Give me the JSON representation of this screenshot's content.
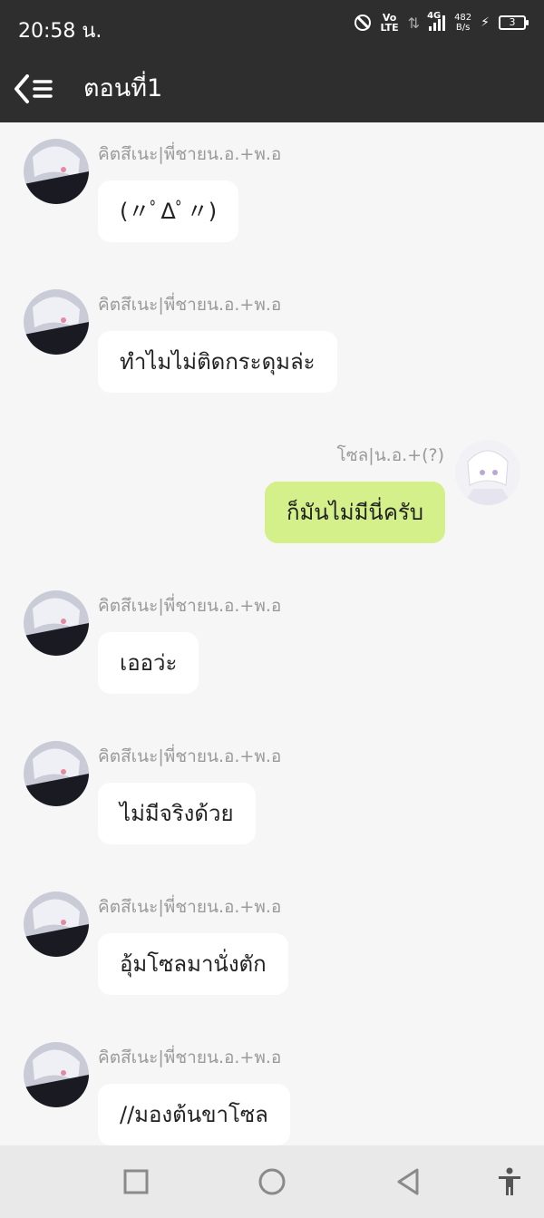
{
  "status_bar": {
    "time": "20:58 น.",
    "volte_top": "Vo",
    "volte_bottom": "LTE",
    "network": "4G",
    "speed_value": "482",
    "speed_unit": "B/s",
    "battery": "3"
  },
  "header": {
    "title": "ตอนที่1",
    "back_icon": "back-menu-icon"
  },
  "messages": [
    {
      "sender": "คิตสึเนะ|พี่ชายน.อ.+พ.อ",
      "text": "(〃ﾟΔﾟ〃)",
      "mine": false
    },
    {
      "sender": "คิตสึเนะ|พี่ชายน.อ.+พ.อ",
      "text": "ทำไมไม่ติดกระดุมล่ะ",
      "mine": false
    },
    {
      "sender": "โซล|น.อ.+(?)",
      "text": "ก็มันไม่มีนี่ครับ",
      "mine": true
    },
    {
      "sender": "คิตสึเนะ|พี่ชายน.อ.+พ.อ",
      "text": "เออว่ะ",
      "mine": false
    },
    {
      "sender": "คิตสึเนะ|พี่ชายน.อ.+พ.อ",
      "text": "ไม่มีจริงด้วย",
      "mine": false
    },
    {
      "sender": "คิตสึเนะ|พี่ชายน.อ.+พ.อ",
      "text": "อุ้มโซลมานั่งตัก",
      "mine": false
    },
    {
      "sender": "คิตสึเนะ|พี่ชายน.อ.+พ.อ",
      "text": "//มองต้นขาโซล",
      "mine": false
    }
  ],
  "colors": {
    "bar_bg": "#2e2e2e",
    "chat_bg": "#f6f6f6",
    "other_bubble": "#ffffff",
    "my_bubble": "#d4f08a"
  },
  "nav": {
    "recent": "square-icon",
    "home": "circle-icon",
    "back": "triangle-back-icon",
    "accessibility": "accessibility-icon"
  }
}
